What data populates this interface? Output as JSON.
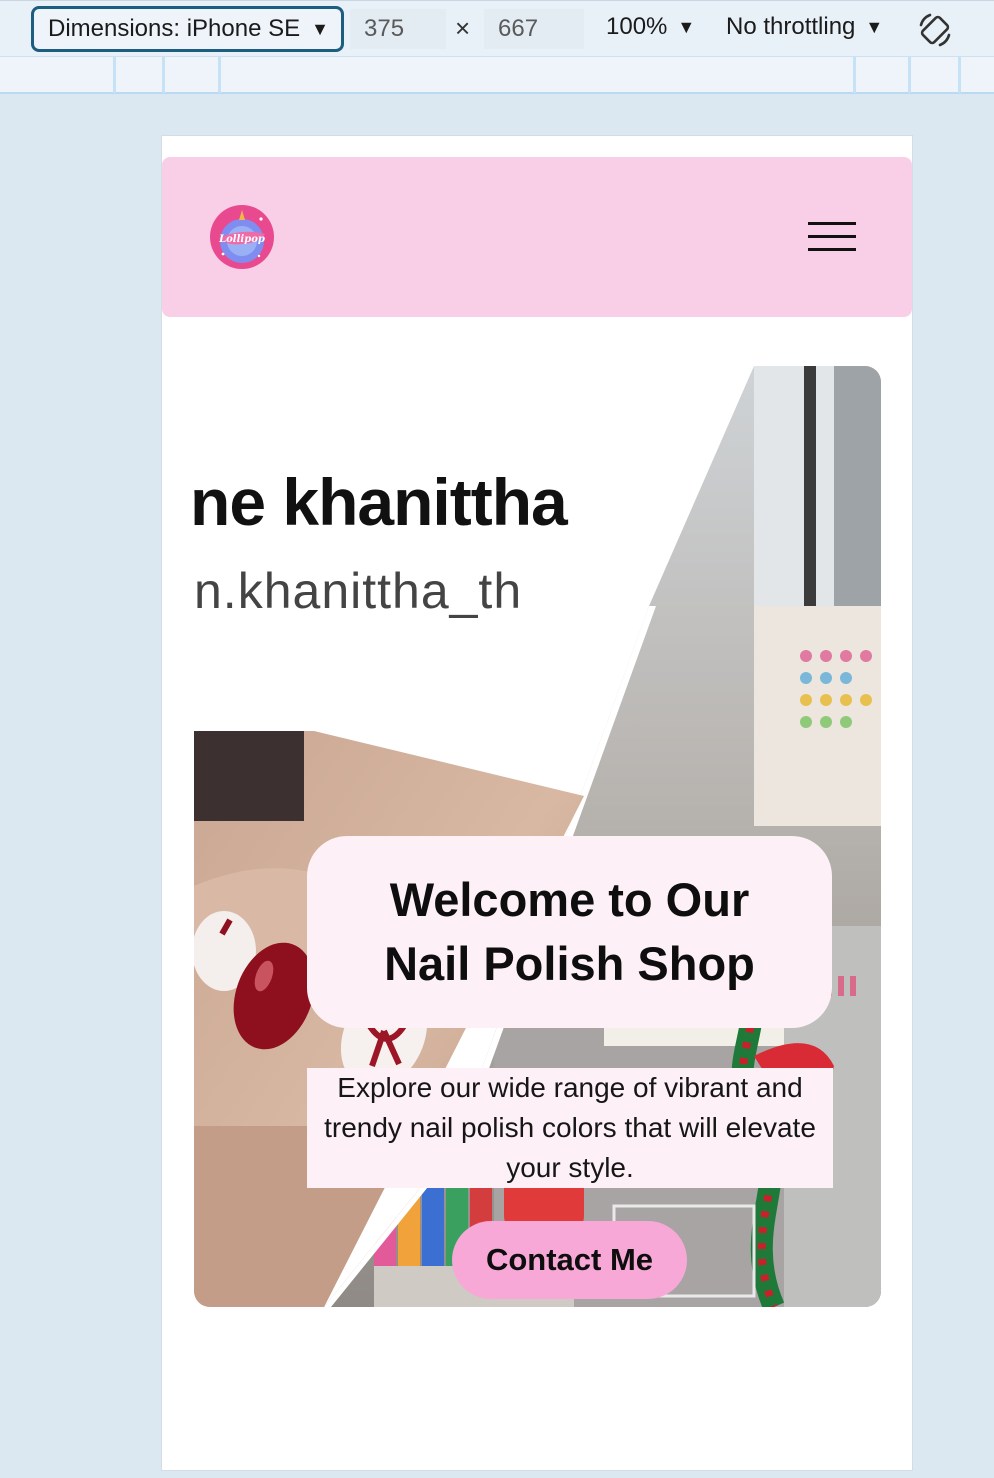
{
  "devtools": {
    "dimensions_label": "Dimensions: iPhone SE",
    "width_value": "375",
    "times_sign": "×",
    "height_value": "667",
    "zoom_label": "100%",
    "throttling_label": "No throttling"
  },
  "site": {
    "logo_text": "Lollipop",
    "hero": {
      "background_name_text": "ne khanittha",
      "background_handle_text": "n.khanittha_th",
      "title_line1": "Welcome to Our",
      "title_line2": "Nail Polish Shop",
      "subtitle": "Explore our wide range of vibrant and trendy nail polish colors that will elevate your style.",
      "cta_label": "Contact Me"
    }
  },
  "colors": {
    "header_pink": "#f9cfe7",
    "card_pink": "#fdf0f6",
    "button_pink": "#f7a8d6",
    "devtools_accent": "#1d5d80"
  }
}
